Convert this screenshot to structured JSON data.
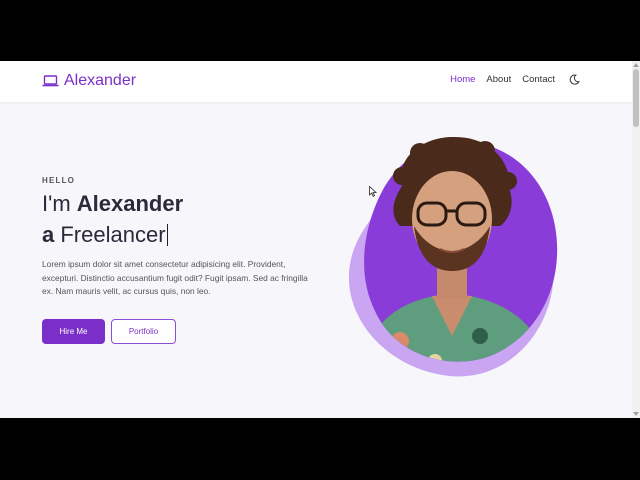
{
  "nav": {
    "brand": "Alexander",
    "links": [
      "Home",
      "About",
      "Contact"
    ],
    "active_link": "Home"
  },
  "hero": {
    "greeting": "HELLO",
    "line1_prefix": "I'm ",
    "line1_name": "Alexander",
    "line2_prefix": "a",
    "line2_role": " Freelancer",
    "description": "Lorem ipsum dolor sit amet consectetur adipisicing elit. Provident, excepturi. Distinctio accusantium fugit odit? Fugit ipsam. Sed ac fringilla ex. Nam mauris velit, ac cursus quis, non leo.",
    "primary_button": "Hire Me",
    "secondary_button": "Portfolio"
  },
  "icons": {
    "brand_icon": "laptop-icon",
    "theme_toggle": "moon-icon"
  },
  "colors": {
    "accent": "#7b2fc9",
    "blob_light": "#c9a5f2",
    "blob_dark": "#8a3cd9",
    "page_bg": "#f7f6fb"
  }
}
